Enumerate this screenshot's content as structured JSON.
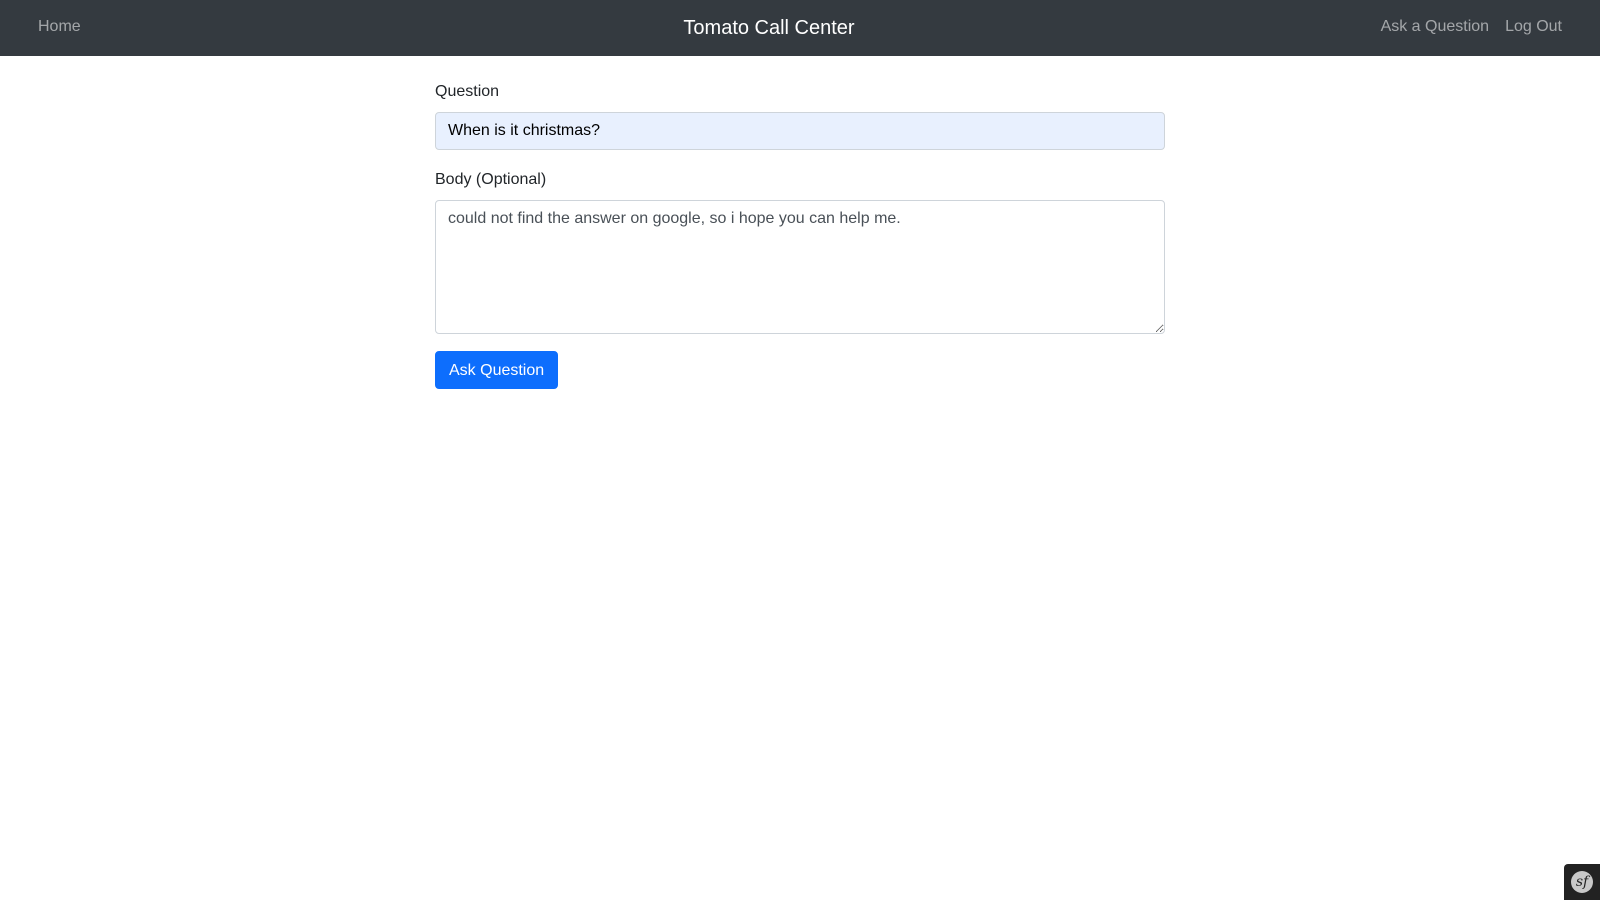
{
  "navbar": {
    "home_label": "Home",
    "brand": "Tomato Call Center",
    "ask_label": "Ask a Question",
    "logout_label": "Log Out"
  },
  "form": {
    "question_label": "Question",
    "question_value": "When is it christmas?",
    "body_label": "Body (Optional)",
    "body_value": "could not find the answer on google, so i hope you can help me.",
    "submit_label": "Ask Question"
  },
  "debug_toolbar": {
    "icon": "symfony-logo-icon",
    "glyph": "sf"
  },
  "colors": {
    "navbar_bg": "#343a40",
    "primary": "#0d6efd",
    "autofill_bg": "#e8f0fe"
  }
}
